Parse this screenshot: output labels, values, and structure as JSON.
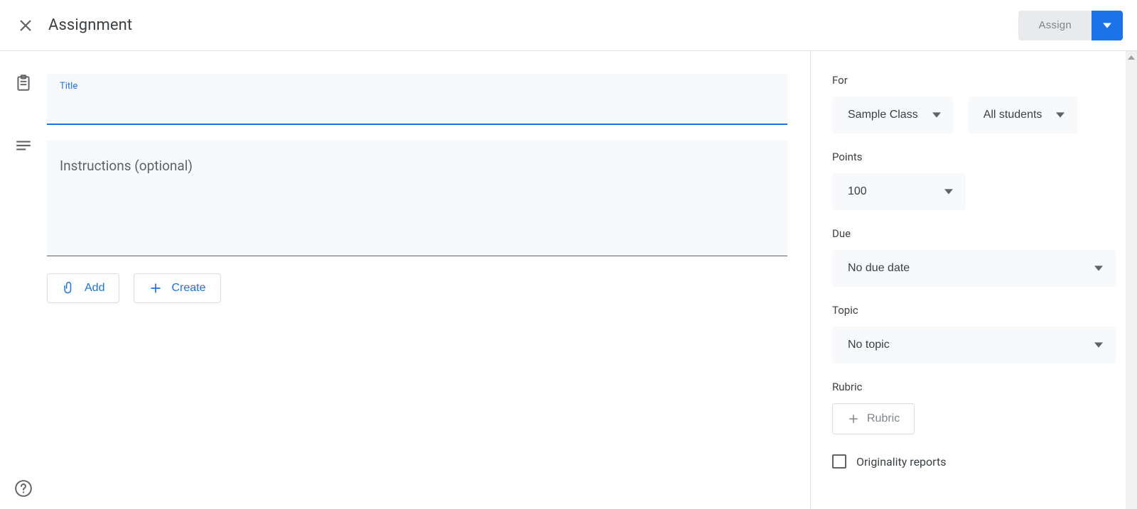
{
  "header": {
    "title": "Assignment",
    "assign_label": "Assign"
  },
  "main": {
    "title_label": "Title",
    "title_value": "",
    "instructions_placeholder": "Instructions (optional)",
    "instructions_value": "",
    "add_button": "Add",
    "create_button": "Create"
  },
  "sidebar": {
    "for": {
      "label": "For",
      "class_value": "Sample Class",
      "students_value": "All students"
    },
    "points": {
      "label": "Points",
      "value": "100"
    },
    "due": {
      "label": "Due",
      "value": "No due date"
    },
    "topic": {
      "label": "Topic",
      "value": "No topic"
    },
    "rubric": {
      "label": "Rubric",
      "button": "Rubric"
    },
    "originality_label": "Originality reports"
  }
}
